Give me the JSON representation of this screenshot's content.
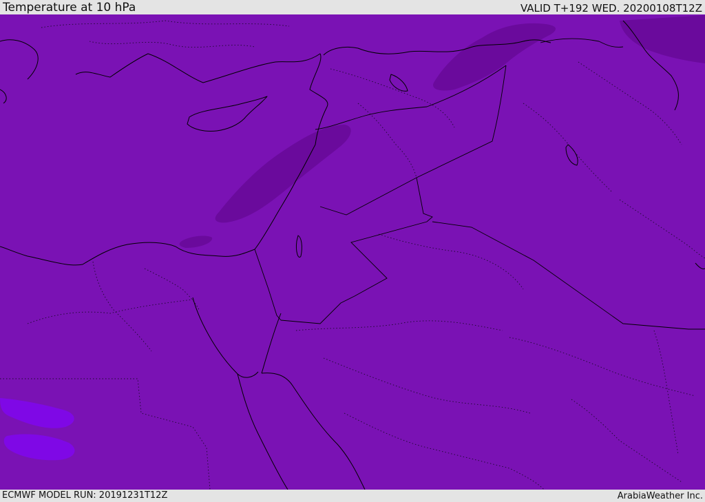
{
  "header": {
    "title": "Temperature at 10 hPa",
    "valid": "VALID T+192 WED. 20200108T12Z"
  },
  "footer": {
    "model_run": "ECMWF MODEL RUN: 20191231T12Z",
    "credit": "ArabiaWeather Inc."
  },
  "colors": {
    "background": "#7a12b4",
    "cold_patch": "#6a0a9c",
    "warm_patch": "#7f08e6",
    "bar": "#e4e4e4"
  }
}
